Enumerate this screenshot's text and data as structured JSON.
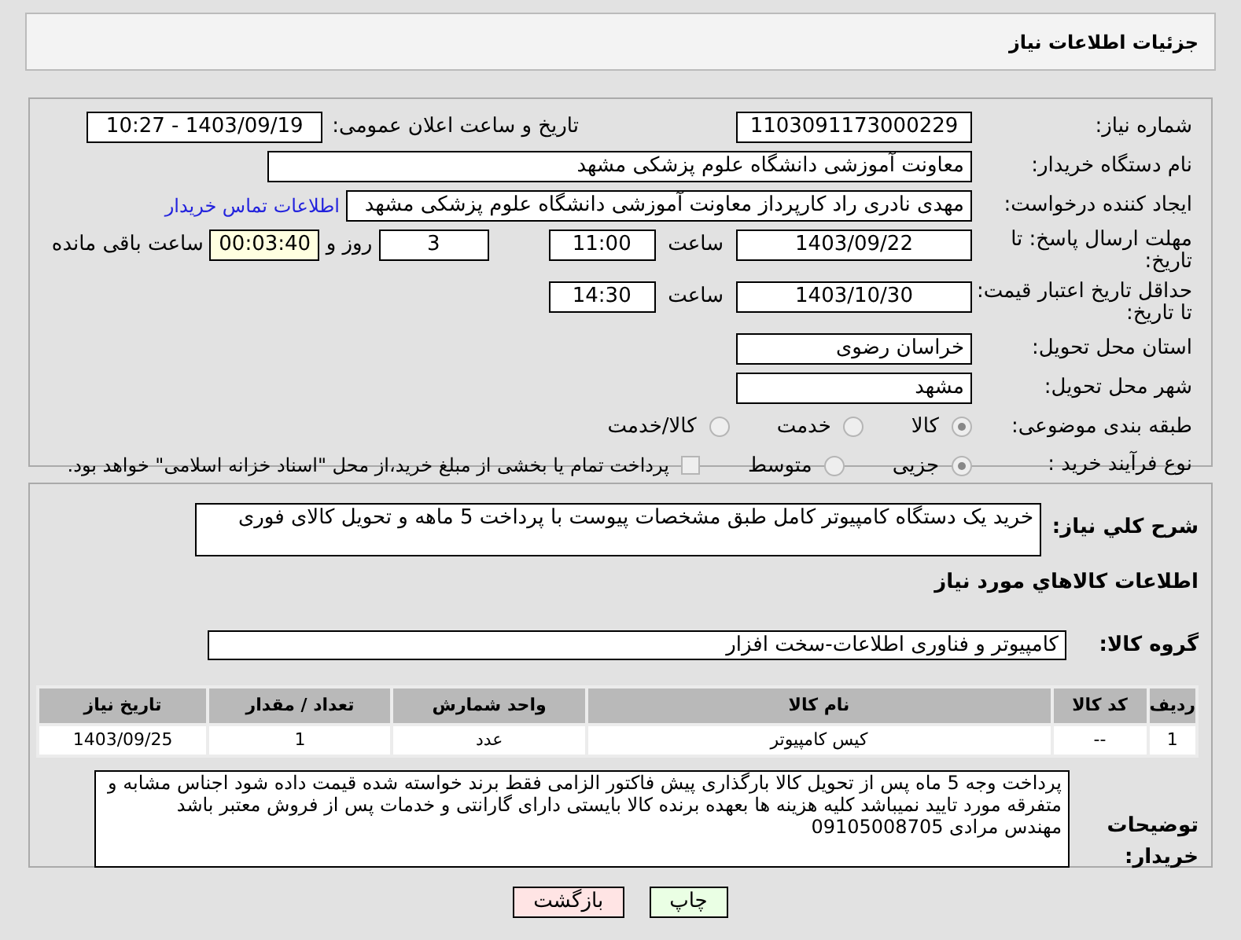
{
  "header": {
    "title": "جزئیات اطلاعات نیاز"
  },
  "need_number": {
    "label": "شماره نیاز:",
    "value": "1103091173000229"
  },
  "announce": {
    "label": "تاریخ و ساعت اعلان عمومی:",
    "value": "1403/09/19 - 10:27"
  },
  "buyer": {
    "label": "نام دستگاه خریدار:",
    "value": "معاونت آموزشی دانشگاه علوم پزشکی مشهد"
  },
  "requester": {
    "label": "ایجاد کننده درخواست:",
    "value": "مهدی نادری راد کارپرداز معاونت آموزشی دانشگاه علوم پزشکی مشهد",
    "link": "اطلاعات تماس خریدار"
  },
  "deadline": {
    "label": "مهلت ارسال پاسخ: تا تاریخ:",
    "date": "1403/09/22",
    "time_label": "ساعت",
    "time": "11:00",
    "days": "3",
    "days_label": "روز و",
    "remaining": "00:03:40",
    "remaining_label": "ساعت باقی مانده"
  },
  "validity": {
    "label": "حداقل تاریخ اعتبار قیمت: تا تاریخ:",
    "date": "1403/10/30",
    "time_label": "ساعت",
    "time": "14:30"
  },
  "province": {
    "label": "استان محل تحویل:",
    "value": "خراسان رضوی"
  },
  "city": {
    "label": "شهر محل تحویل:",
    "value": "مشهد"
  },
  "category": {
    "label": "طبقه بندی موضوعی:",
    "options": [
      {
        "label": "کالا",
        "selected": true
      },
      {
        "label": "خدمت",
        "selected": false
      },
      {
        "label": "کالا/خدمت",
        "selected": false
      }
    ]
  },
  "process": {
    "label": "نوع فرآیند خرید :",
    "options": [
      {
        "label": "جزیی",
        "selected": true
      },
      {
        "label": "متوسط",
        "selected": false
      }
    ],
    "treasury": {
      "label": "پرداخت تمام یا بخشی از مبلغ خرید،از محل \"اسناد خزانه اسلامی\" خواهد بود.",
      "checked": false
    }
  },
  "description": {
    "label": "شرح کلي نياز:",
    "value": "خرید یک دستگاه کامپیوتر کامل طبق مشخصات پیوست با پرداخت 5 ماهه و تحویل کالای فوری"
  },
  "items_title": "اطلاعات کالاهاي مورد نياز",
  "goods_group": {
    "label": "گروه کالا:",
    "value": "کامپیوتر و فناوری اطلاعات-سخت افزار"
  },
  "table": {
    "columns": [
      "ردیف",
      "کد کالا",
      "نام کالا",
      "واحد شمارش",
      "تعداد / مقدار",
      "تاریخ نیاز"
    ],
    "rows": [
      {
        "cells": [
          "1",
          "--",
          "کیس کامپیوتر",
          "عدد",
          "1",
          "1403/09/25"
        ]
      }
    ]
  },
  "buyer_notes": {
    "label": "توضیحات خریدار:",
    "lines": [
      "پرداخت وجه 5 ماه پس از تحویل کالا بارگذاری پیش فاکتور الزامی فقط برند خواسته شده قیمت داده شود اجناس مشابه و",
      "متفرقه مورد تایید نمیباشد کلیه هزینه ها بعهده برنده کالا بایستی دارای گارانتی و خدمات پس از فروش معتبر باشد",
      "مهندس مرادی 09105008705"
    ]
  },
  "buttons": [
    {
      "label": "چاپ",
      "kind": "print"
    },
    {
      "label": "بازگشت",
      "kind": "back"
    }
  ]
}
